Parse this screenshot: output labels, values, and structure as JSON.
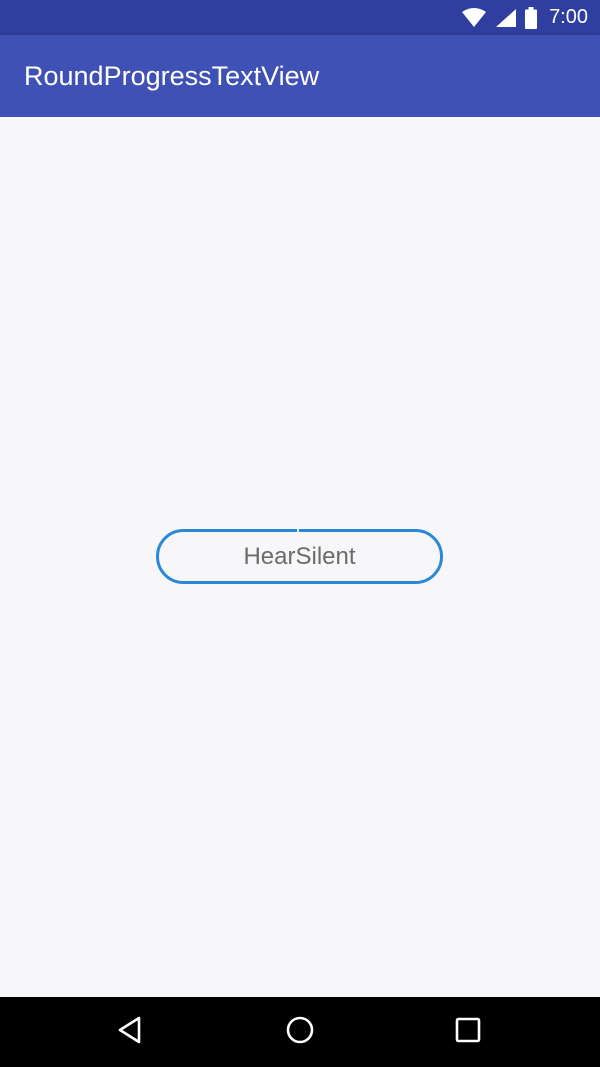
{
  "status_bar": {
    "time": "7:00",
    "icons": [
      "wifi-icon",
      "signal-icon",
      "battery-icon"
    ]
  },
  "app_bar": {
    "title": "RoundProgressTextView",
    "color": "#3f51b5",
    "status_color": "#303f9f"
  },
  "main": {
    "round_progress_text": "HearSilent",
    "progress_color": "#2b88d8"
  },
  "nav_bar": {
    "buttons": [
      "back-icon",
      "home-icon",
      "recents-icon"
    ]
  }
}
